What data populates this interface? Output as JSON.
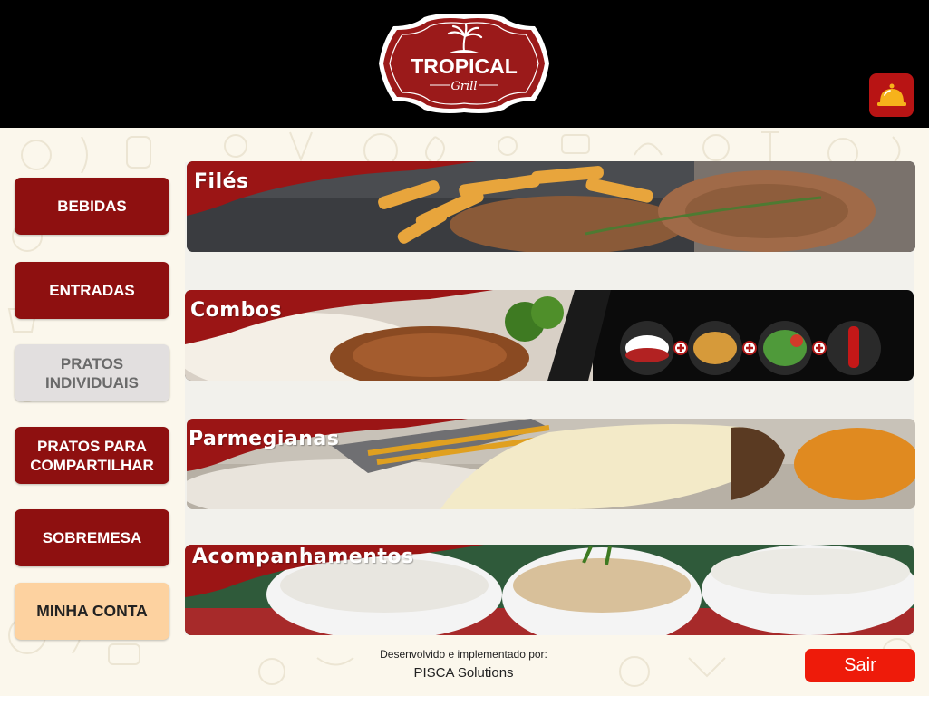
{
  "header": {
    "logo_main": "TROPICAL",
    "logo_sub": "Grill",
    "bell_icon": "service-bell-icon"
  },
  "nav": {
    "bebidas": "BEBIDAS",
    "entradas": "ENTRADAS",
    "pratos_individuais": "PRATOS INDIVIDUAIS",
    "pratos_compartilhar": "PRATOS PARA COMPARTILHAR",
    "sobremesa": "SOBREMESA",
    "minha_conta": "MINHA CONTA"
  },
  "categories": {
    "files": "Filés",
    "combos": "Combos",
    "parmegianas": "Parmegianas",
    "acompanhamentos": "Acompanhamentos"
  },
  "footer": {
    "credit_line": "Desenvolvido e implementado por:",
    "company": "PISCA Solutions",
    "exit_label": "Sair"
  },
  "colors": {
    "brand_red": "#8e1010",
    "bell_red": "#b81414",
    "exit_red": "#ee1b0a",
    "account_peach": "#fdd2a0",
    "inactive_gray": "#e2dfdf"
  }
}
